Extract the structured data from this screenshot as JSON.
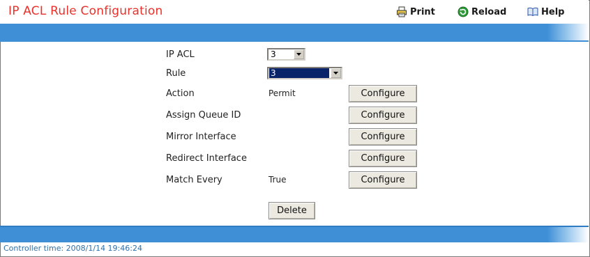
{
  "header": {
    "title": "IP ACL Rule Configuration",
    "print_label": "Print",
    "reload_label": "Reload",
    "help_label": "Help"
  },
  "form": {
    "ip_acl_label": "IP ACL",
    "ip_acl_value": "3",
    "rule_label": "Rule",
    "rule_value": "3",
    "action_label": "Action",
    "action_value": "Permit",
    "assign_queue_label": "Assign Queue ID",
    "mirror_interface_label": "Mirror Interface",
    "redirect_interface_label": "Redirect Interface",
    "match_every_label": "Match Every",
    "match_every_value": "True",
    "configure_label": "Configure",
    "delete_label": "Delete"
  },
  "status": {
    "controller_time": "Controller time: 2008/1/14 19:46:24"
  },
  "colors": {
    "title": "#e8312a",
    "band": "#3f8fd6",
    "status_text": "#2e6fa8"
  }
}
